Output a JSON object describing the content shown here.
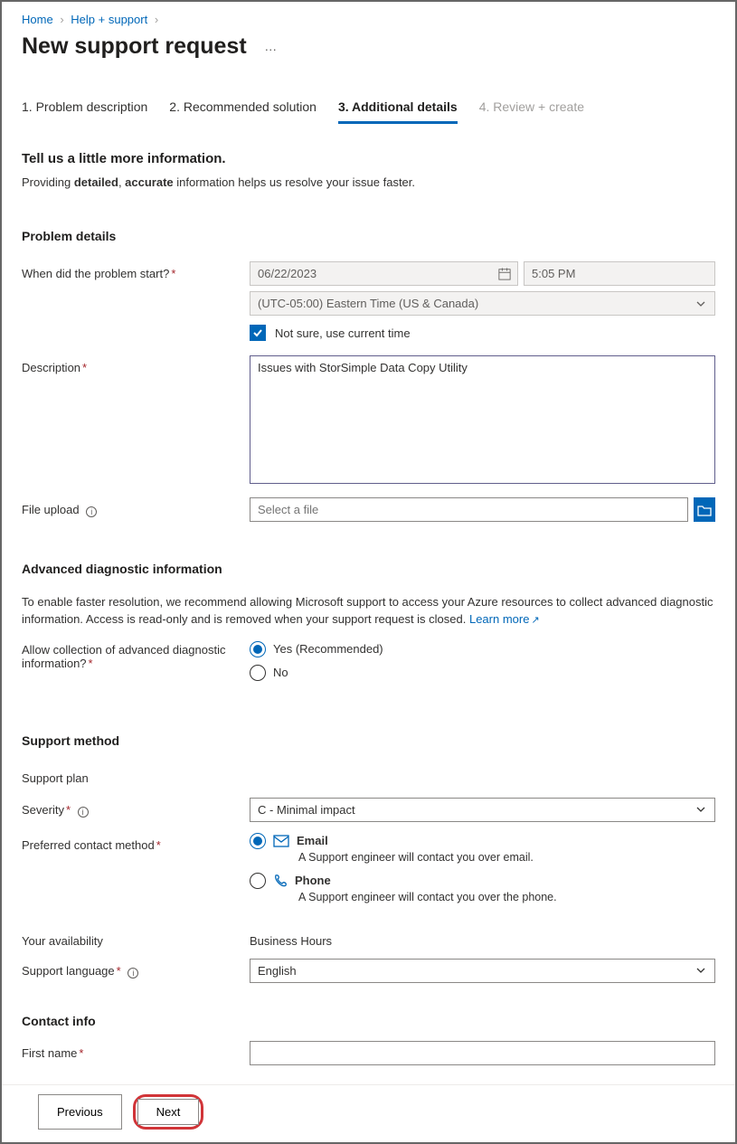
{
  "breadcrumb": {
    "home": "Home",
    "help": "Help + support"
  },
  "pageTitle": "New support request",
  "tabs": [
    {
      "label": "1. Problem description"
    },
    {
      "label": "2. Recommended solution"
    },
    {
      "label": "3. Additional details"
    },
    {
      "label": "4. Review + create"
    }
  ],
  "intro": {
    "heading": "Tell us a little more information.",
    "prefix": "Providing ",
    "b1": "detailed",
    "sep": ", ",
    "b2": "accurate",
    "suffix": " information helps us resolve your issue faster."
  },
  "problem": {
    "header": "Problem details",
    "whenLabel": "When did the problem start?",
    "date": "06/22/2023",
    "time": "5:05 PM",
    "timezone": "(UTC-05:00) Eastern Time (US & Canada)",
    "notSure": "Not sure, use current time",
    "descriptionLabel": "Description",
    "descriptionValue": "Issues with StorSimple Data Copy Utility",
    "fileUploadLabel": "File upload",
    "filePlaceholder": "Select a file"
  },
  "adv": {
    "header": "Advanced diagnostic information",
    "text": "To enable faster resolution, we recommend allowing Microsoft support to access your Azure resources to collect advanced diagnostic information. Access is read-only and is removed when your support request is closed. ",
    "learnMore": "Learn more",
    "allowLabel": "Allow collection of advanced diagnostic information?",
    "yes": "Yes (Recommended)",
    "no": "No"
  },
  "support": {
    "header": "Support method",
    "planLabel": "Support plan",
    "severityLabel": "Severity",
    "severityValue": "C - Minimal impact",
    "contactLabel": "Preferred contact method",
    "email": {
      "title": "Email",
      "desc": "A Support engineer will contact you over email."
    },
    "phone": {
      "title": "Phone",
      "desc": "A Support engineer will contact you over the phone."
    },
    "availLabel": "Your availability",
    "availValue": "Business Hours",
    "langLabel": "Support language",
    "langValue": "English"
  },
  "contact": {
    "header": "Contact info",
    "firstNameLabel": "First name"
  },
  "footer": {
    "prev": "Previous",
    "next": "Next"
  }
}
